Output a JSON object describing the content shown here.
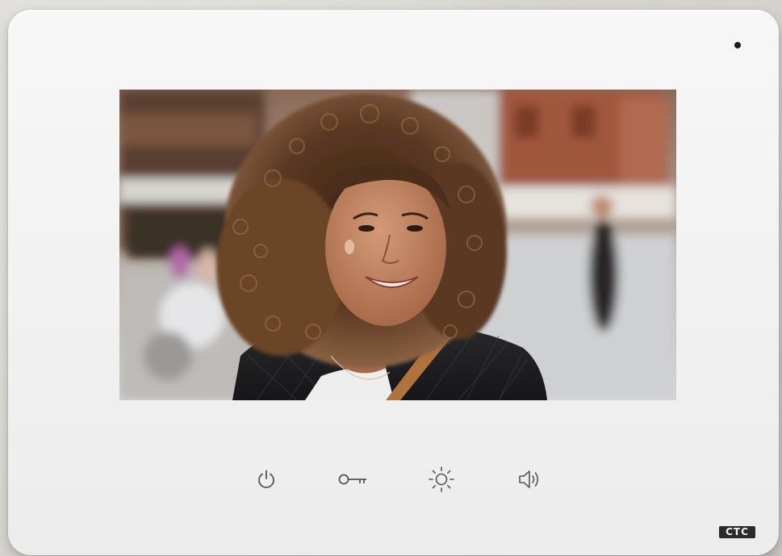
{
  "device": {
    "brand_logo": "CTC",
    "body_color": "#f4f4f4"
  },
  "screen": {
    "content": "video-feed-person-smiling"
  },
  "controls": [
    {
      "name": "power-button",
      "icon": "power-icon"
    },
    {
      "name": "unlock-button",
      "icon": "key-icon"
    },
    {
      "name": "brightness-button",
      "icon": "sun-icon"
    },
    {
      "name": "volume-button",
      "icon": "speaker-icon"
    }
  ]
}
